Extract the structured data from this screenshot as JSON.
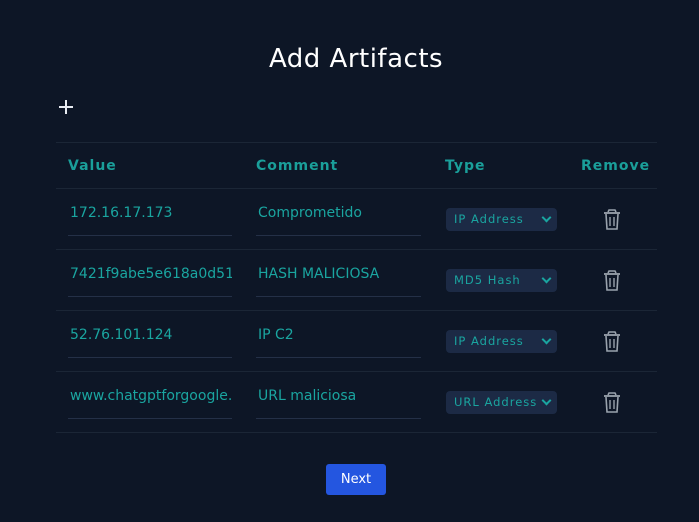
{
  "page": {
    "title": "Add Artifacts"
  },
  "icons": {
    "add": "plus-icon",
    "remove": "trash-icon",
    "dropdown": "chevron-down-icon"
  },
  "colors": {
    "background": "#0d1626",
    "accent": "#1aa5a0",
    "primary_button": "#2456e0",
    "select_bg": "#1c2a45"
  },
  "table": {
    "headers": {
      "value": "Value",
      "comment": "Comment",
      "type": "Type",
      "remove": "Remove"
    },
    "rows": [
      {
        "value": "172.16.17.173",
        "comment": "Comprometido",
        "type": "IP Address"
      },
      {
        "value": "7421f9abe5e618a0d51",
        "comment": "HASH MALICIOSA",
        "type": "MD5 Hash"
      },
      {
        "value": "52.76.101.124",
        "comment": "IP C2",
        "type": "IP Address"
      },
      {
        "value": "www.chatgptforgoogle.",
        "comment": "URL maliciosa",
        "type": "URL Address"
      }
    ]
  },
  "actions": {
    "next_label": "Next"
  }
}
